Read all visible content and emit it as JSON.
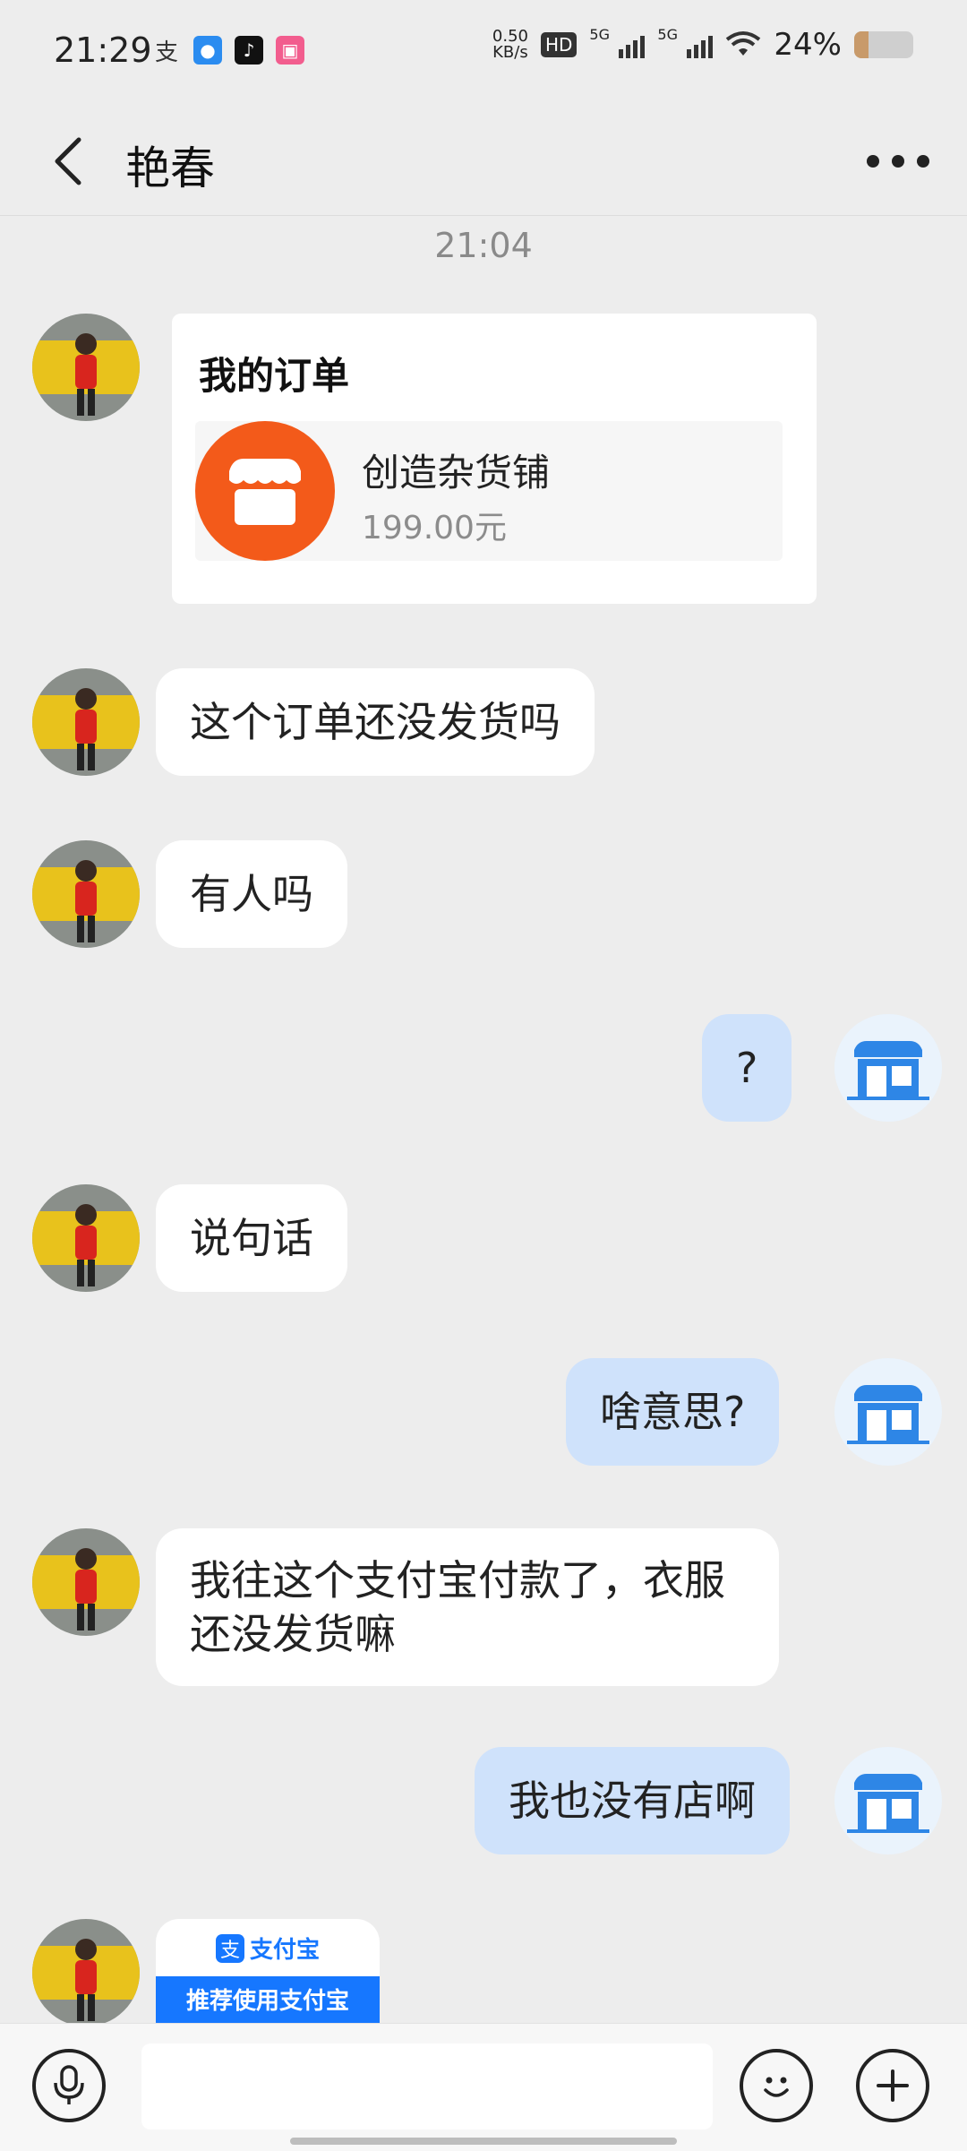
{
  "status_bar": {
    "time": "21:29",
    "net_speed_value": "0.50",
    "net_speed_unit": "KB/s",
    "hd_label": "HD",
    "signal_1_label": "5G",
    "signal_2_label": "5G",
    "battery_percent": "24%",
    "battery_level": 0.24,
    "left_icons": [
      "alipay-icon",
      "browser-icon",
      "tiktok-icon",
      "bilibili-icon"
    ]
  },
  "nav": {
    "title": "艳春"
  },
  "chat": {
    "timestamp": "21:04",
    "order_card": {
      "title": "我的订单",
      "shop_name": "创造杂货铺",
      "price": "199.00元"
    },
    "messages": [
      {
        "from": "them",
        "text": "这个订单还没发货吗"
      },
      {
        "from": "them",
        "text": "有人吗"
      },
      {
        "from": "me",
        "text": "?"
      },
      {
        "from": "them",
        "text": "说句话"
      },
      {
        "from": "me",
        "text": "啥意思?"
      },
      {
        "from": "them",
        "text": "我往这个支付宝付款了，衣服还没发货嘛"
      },
      {
        "from": "me",
        "text": "我也没有店啊"
      }
    ],
    "alipay_card": {
      "logo_char": "支",
      "brand": "支付宝",
      "cta": "推荐使用支付宝"
    }
  },
  "input_bar": {
    "placeholder": "",
    "icons": [
      "microphone-icon",
      "emoji-icon",
      "plus-icon"
    ]
  },
  "colors": {
    "background": "#ededed",
    "incoming_bubble": "#ffffff",
    "outgoing_bubble": "#cfe2fb",
    "shop_orange": "#f35a1a",
    "alipay_blue": "#1677ff"
  }
}
